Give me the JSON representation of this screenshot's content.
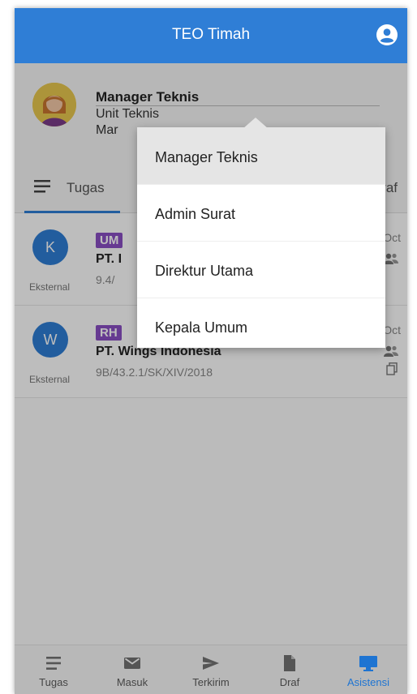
{
  "app": {
    "title": "TEO Timah"
  },
  "profile": {
    "name": "Manager Teknis",
    "unit": "Unit Teknis",
    "role_partial": "Mar"
  },
  "tabs": [
    {
      "label": "Tugas"
    },
    {
      "label": "Draf"
    }
  ],
  "items": [
    {
      "initial": "K",
      "source": "Eksternal",
      "badge": "UM",
      "org": "PT. I",
      "number": "9.4/",
      "date": "4 Oct"
    },
    {
      "initial": "W",
      "source": "Eksternal",
      "badge": "RH",
      "org": "PT. Wings Indonesia",
      "number": "9B/43.2.1/SK/XIV/2018",
      "date": "4 Oct"
    }
  ],
  "dropdown": {
    "options": [
      "Manager Teknis",
      "Admin Surat",
      "Direktur Utama",
      "Kepala Umum"
    ],
    "selected": "Manager Teknis"
  },
  "bottom_nav": [
    {
      "label": "Tugas",
      "icon": "list-icon"
    },
    {
      "label": "Masuk",
      "icon": "mail-icon"
    },
    {
      "label": "Terkirim",
      "icon": "send-icon"
    },
    {
      "label": "Draf",
      "icon": "document-icon"
    },
    {
      "label": "Asistensi",
      "icon": "monitor-icon",
      "active": true
    }
  ],
  "colors": {
    "primary": "#2f7ed6",
    "badge": "#8a4fc4",
    "active_nav": "#1e74d2"
  }
}
